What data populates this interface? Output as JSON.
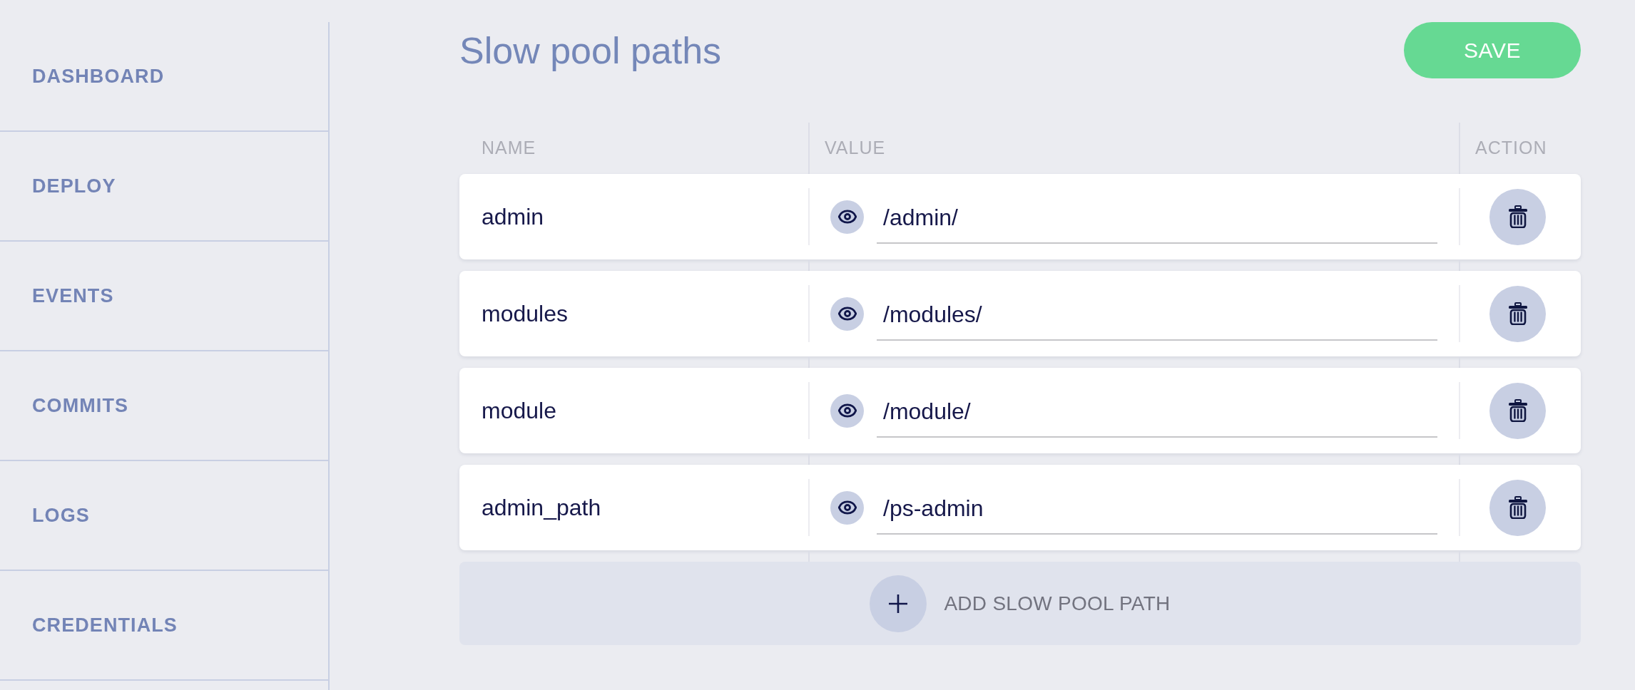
{
  "sidebar": {
    "items": [
      {
        "label": "DASHBOARD"
      },
      {
        "label": "DEPLOY"
      },
      {
        "label": "EVENTS"
      },
      {
        "label": "COMMITS"
      },
      {
        "label": "LOGS"
      },
      {
        "label": "CREDENTIALS"
      }
    ]
  },
  "header": {
    "title": "Slow pool paths",
    "save_button": "SAVE"
  },
  "table": {
    "columns": [
      "NAME",
      "VALUE",
      "ACTION"
    ],
    "rows": [
      {
        "name": "admin",
        "value": "/admin/"
      },
      {
        "name": "modules",
        "value": "/modules/"
      },
      {
        "name": "module",
        "value": "/module/"
      },
      {
        "name": "admin_path",
        "value": "/ps-admin"
      }
    ]
  },
  "add_button": {
    "label": "ADD SLOW POOL PATH"
  }
}
